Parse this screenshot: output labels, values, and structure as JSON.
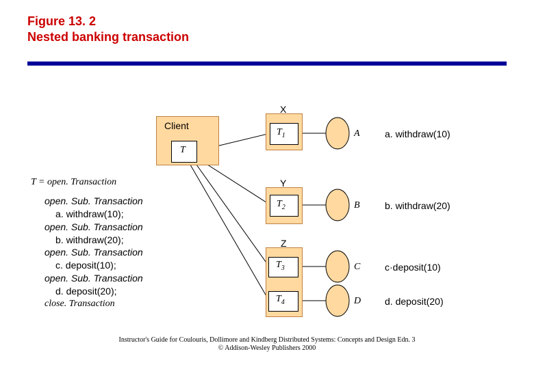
{
  "title_line1": "Figure 13. 2",
  "title_line2": "Nested banking transaction",
  "client": {
    "label": "Client",
    "T": "T"
  },
  "servers": {
    "X": {
      "siteLabel": "X",
      "txLabel": "T",
      "txSub": "1",
      "objLabel": "A",
      "operation": "a. withdraw(10)"
    },
    "Y": {
      "siteLabel": "Y",
      "txLabel": "T",
      "txSub": "2",
      "objLabel": "B",
      "operation": "b. withdraw(20)"
    },
    "Z_C": {
      "siteLabel": "Z",
      "txLabel": "T",
      "txSub": "3",
      "objLabel": "C",
      "operation": "c·deposit(10)"
    },
    "Z_D": {
      "txLabel": "T",
      "txSub": "4",
      "objLabel": "D",
      "operation": "d. deposit(20)"
    }
  },
  "code": {
    "line1": "T = open. Transaction",
    "sub_label": "open. Sub. Transaction",
    "l1": "a. withdraw(10);",
    "l2": "b. withdraw(20);",
    "l3": "c. deposit(10);",
    "l4": "d. deposit(20);",
    "close": "close. Transaction"
  },
  "footer": {
    "line1": "Instructor's Guide for Coulouris, Dollimore and Kindberg  Distributed Systems: Concepts and Design  Edn. 3",
    "line2": "© Addison-Wesley Publishers 2000"
  },
  "colors": {
    "titleRed": "#cc0000",
    "ruleBlue": "#000099",
    "orange": "#ffd9a0"
  }
}
